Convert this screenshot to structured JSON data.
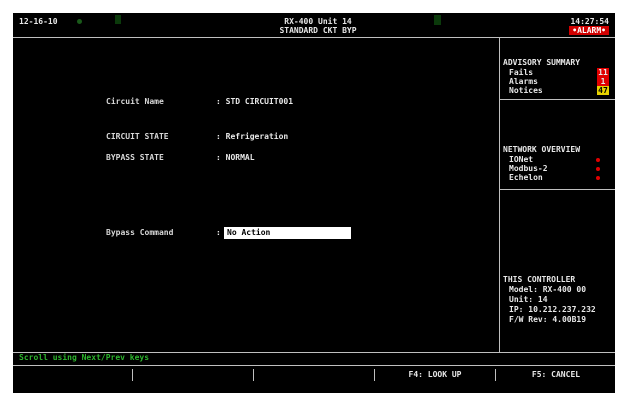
{
  "header": {
    "date": "12-16-10",
    "title_line1": "RX-400 Unit 14",
    "title_line2": "STANDARD CKT BYP",
    "time": "14:27:54",
    "alarm": "•ALARM•"
  },
  "main": {
    "circuit_name_label": "Circuit Name",
    "circuit_name_value": ": STD CIRCUIT001",
    "circuit_state_label": "CIRCUIT STATE",
    "circuit_state_value": ": Refrigeration",
    "bypass_state_label": "BYPASS STATE",
    "bypass_state_value": ": NORMAL",
    "bypass_command_label": "Bypass Command",
    "bypass_command_colon": ":",
    "bypass_command_value": "No Action"
  },
  "advisory": {
    "title": "ADVISORY SUMMARY",
    "items": [
      {
        "label": "Fails",
        "count": "11",
        "color": "#e00000"
      },
      {
        "label": "Alarms",
        "count": "1",
        "color": "#e00000"
      },
      {
        "label": "Notices",
        "count": "47",
        "color": "#e6d200"
      }
    ]
  },
  "network": {
    "title": "NETWORK OVERVIEW",
    "items": [
      {
        "label": "IONet",
        "status_color": "#e00000"
      },
      {
        "label": "Modbus-2",
        "status_color": "#e00000"
      },
      {
        "label": "Echelon",
        "status_color": "#e00000"
      }
    ]
  },
  "controller": {
    "title": "THIS CONTROLLER",
    "model": "Model: RX-400  00",
    "unit": "Unit: 14",
    "ip": "IP: 10.212.237.232",
    "fw": "F/W Rev: 4.00B19"
  },
  "footer": {
    "message": "Scroll using Next/Prev keys",
    "f4_label": "F4: LOOK UP",
    "f5_label": "F5: CANCEL"
  }
}
